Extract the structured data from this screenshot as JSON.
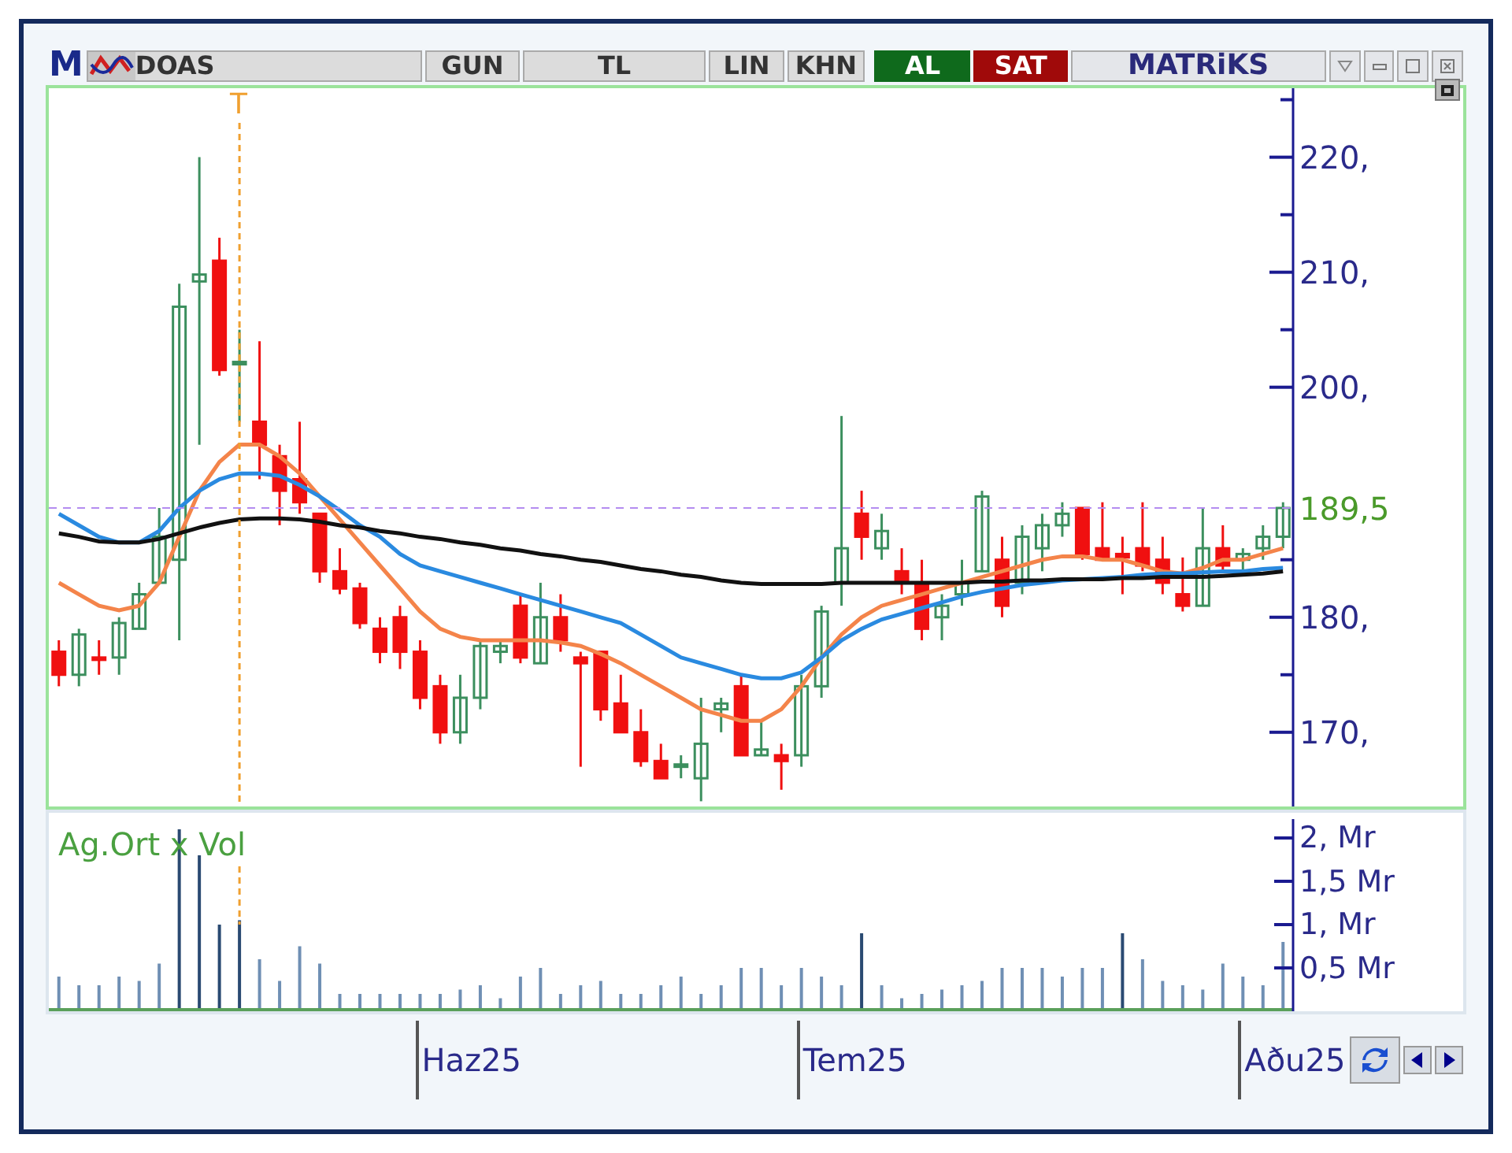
{
  "toolbar": {
    "logo": "M",
    "symbol": "DOAS",
    "buttons": [
      {
        "label": "GUN"
      },
      {
        "label": "TL"
      },
      {
        "label": "LIN"
      },
      {
        "label": "KHN"
      }
    ],
    "buy": "AL",
    "sell": "SAT",
    "brand": "MATRiKS"
  },
  "price_chart": {
    "chart_data": {
      "type": "candlestick",
      "categories": [
        null,
        null,
        null,
        null,
        null,
        null,
        null,
        null,
        null,
        null,
        null,
        null,
        null,
        null,
        null,
        null,
        null,
        null,
        null,
        null,
        null,
        null,
        null,
        null,
        null,
        null,
        null,
        null,
        null,
        null,
        null,
        null,
        null,
        null,
        null,
        null,
        null,
        null,
        null,
        null,
        null,
        null,
        null,
        null,
        null,
        null,
        null,
        null,
        null,
        null,
        null,
        null,
        null,
        null,
        null,
        null,
        null,
        null,
        null,
        null,
        null,
        null
      ],
      "ylim": [
        163,
        226
      ],
      "yticks": [
        {
          "value": 170,
          "label": "170,"
        },
        {
          "value": 180,
          "label": "180,"
        },
        {
          "value": 200,
          "label": "200,"
        },
        {
          "value": 210,
          "label": "210,"
        },
        {
          "value": 220,
          "label": "220,"
        }
      ],
      "ohlc": [
        [
          177,
          178,
          174,
          175
        ],
        [
          175,
          179,
          174,
          178.5
        ],
        [
          176.5,
          178,
          175,
          176.3
        ],
        [
          176.5,
          180,
          175,
          179.5
        ],
        [
          179,
          183,
          179,
          182
        ],
        [
          183,
          189.5,
          183,
          187
        ],
        [
          185,
          209,
          178,
          207
        ],
        [
          209.2,
          220,
          195,
          209.8
        ],
        [
          211,
          213,
          201,
          201.5
        ],
        [
          202,
          205,
          197,
          202.2
        ],
        [
          197,
          204,
          192,
          195
        ],
        [
          194,
          195,
          188,
          191
        ],
        [
          192,
          197,
          189,
          190
        ],
        [
          189,
          189,
          183,
          184
        ],
        [
          184,
          186,
          182,
          182.5
        ],
        [
          182.5,
          183,
          179,
          179.5
        ],
        [
          179,
          180,
          176,
          177
        ],
        [
          180,
          181,
          175.5,
          177
        ],
        [
          177,
          178,
          172,
          173
        ],
        [
          174,
          175,
          169,
          170
        ],
        [
          170,
          175,
          169,
          173
        ],
        [
          173,
          178,
          172,
          177.5
        ],
        [
          177,
          178,
          176,
          177.5
        ],
        [
          181,
          182,
          176,
          176.5
        ],
        [
          176,
          183,
          176,
          180
        ],
        [
          180,
          182,
          177,
          178
        ],
        [
          176.5,
          177,
          167,
          176
        ],
        [
          177,
          177,
          171,
          172
        ],
        [
          172.5,
          175,
          170,
          170
        ],
        [
          170,
          172,
          167,
          167.5
        ],
        [
          167.5,
          169,
          166,
          166
        ],
        [
          167,
          168,
          166,
          167.2
        ],
        [
          166,
          173,
          164,
          169
        ],
        [
          172,
          173,
          170,
          172.5
        ],
        [
          174,
          175,
          168,
          168
        ],
        [
          168,
          171,
          168,
          168.5
        ],
        [
          168,
          169,
          165,
          167.5
        ],
        [
          168,
          175,
          167,
          174
        ],
        [
          174,
          181,
          173,
          180.5
        ],
        [
          183,
          197.5,
          181,
          186
        ],
        [
          189,
          191,
          185,
          187
        ],
        [
          186,
          189,
          185,
          187.5
        ],
        [
          184,
          186,
          182,
          183
        ],
        [
          183,
          185,
          178,
          179
        ],
        [
          180,
          182,
          178,
          181
        ],
        [
          182,
          185,
          181,
          183
        ],
        [
          184,
          191,
          184,
          190.5
        ],
        [
          185,
          187,
          180,
          181
        ],
        [
          183,
          188,
          182,
          187
        ],
        [
          186,
          189,
          184,
          188
        ],
        [
          188,
          190,
          187,
          189
        ],
        [
          189.5,
          189.5,
          185,
          185.5
        ],
        [
          186,
          190,
          185,
          185
        ],
        [
          185.5,
          187,
          182,
          185.2
        ],
        [
          186,
          190,
          184,
          184.5
        ],
        [
          185,
          187,
          182,
          183
        ],
        [
          182,
          185.2,
          180.5,
          181
        ],
        [
          181,
          189.5,
          181,
          186
        ],
        [
          186,
          188,
          184,
          184.5
        ],
        [
          185,
          186,
          184,
          185.5
        ],
        [
          186,
          188,
          185,
          187
        ],
        [
          187,
          190,
          186,
          189.5
        ]
      ],
      "series": [
        {
          "type": "line",
          "color": "#f4844a",
          "values": [
            183,
            182,
            181,
            180.6,
            181,
            183,
            187,
            191,
            193.5,
            195,
            195,
            194,
            192.5,
            190.5,
            188.5,
            186.5,
            184.5,
            182.5,
            180.5,
            179,
            178.3,
            178,
            178,
            178,
            178,
            177.8,
            177.5,
            176.8,
            176,
            175,
            174,
            173,
            172,
            171.5,
            171,
            171,
            172,
            174,
            176.5,
            178.5,
            180,
            181,
            181.5,
            182,
            182.5,
            183,
            183.5,
            184,
            184.5,
            185,
            185.3,
            185.3,
            185,
            185,
            184.5,
            184,
            183.8,
            184.3,
            185,
            185,
            185.5,
            186
          ]
        },
        {
          "type": "line",
          "color": "#2a8ae0",
          "values": [
            189,
            188,
            187,
            186.5,
            186.5,
            187.5,
            189.5,
            191,
            192,
            192.5,
            192.5,
            192.3,
            191.5,
            190.5,
            189.3,
            188,
            187,
            185.5,
            184.5,
            184,
            183.5,
            183,
            182.5,
            182,
            181.5,
            181,
            180.5,
            180,
            179.5,
            178.5,
            177.5,
            176.5,
            176,
            175.5,
            175,
            174.7,
            174.7,
            175.2,
            176.5,
            178,
            179,
            179.8,
            180.3,
            180.8,
            181.3,
            181.8,
            182.2,
            182.5,
            182.8,
            183,
            183.2,
            183.3,
            183.4,
            183.5,
            183.7,
            183.8,
            183.8,
            183.9,
            184,
            184,
            184.2,
            184.3
          ]
        },
        {
          "type": "line",
          "color": "#111111",
          "values": [
            187.3,
            187,
            186.6,
            186.5,
            186.5,
            186.8,
            187.3,
            187.8,
            188.2,
            188.5,
            188.6,
            188.6,
            188.5,
            188.3,
            188,
            187.8,
            187.5,
            187.3,
            187,
            186.8,
            186.5,
            186.3,
            186,
            185.8,
            185.5,
            185.3,
            185,
            184.8,
            184.5,
            184.2,
            184,
            183.7,
            183.5,
            183.2,
            183,
            182.9,
            182.9,
            182.9,
            182.9,
            183,
            183,
            183,
            183,
            183,
            183,
            183,
            183.1,
            183.1,
            183.2,
            183.2,
            183.3,
            183.3,
            183.3,
            183.4,
            183.4,
            183.5,
            183.5,
            183.5,
            183.6,
            183.7,
            183.8,
            184
          ]
        }
      ],
      "ref_lines": [
        {
          "axis": "y",
          "value": 189.5,
          "label": "189,5"
        }
      ],
      "annotations": [
        "T"
      ]
    }
  },
  "volume_chart": {
    "chart_data": {
      "type": "bar",
      "title": "Ag.Ort x Vol",
      "categories": [
        null,
        null,
        null,
        null,
        null,
        null,
        null,
        null,
        null,
        null,
        null,
        null,
        null,
        null,
        null,
        null,
        null,
        null,
        null,
        null,
        null,
        null,
        null,
        null,
        null,
        null,
        null,
        null,
        null,
        null,
        null,
        null,
        null,
        null,
        null,
        null,
        null,
        null,
        null,
        null,
        null,
        null,
        null,
        null,
        null,
        null,
        null,
        null,
        null,
        null,
        null,
        null,
        null,
        null,
        null,
        null,
        null,
        null,
        null,
        null,
        null,
        null
      ],
      "ylim": [
        0,
        2.2
      ],
      "yticks": [
        {
          "value": 0.5,
          "label": "0,5 Mr"
        },
        {
          "value": 1,
          "label": "1, Mr"
        },
        {
          "value": 1.5,
          "label": "1,5 Mr"
        },
        {
          "value": 2,
          "label": "2, Mr"
        }
      ],
      "values": [
        0.4,
        0.3,
        0.3,
        0.4,
        0.35,
        0.55,
        2.1,
        1.8,
        1.0,
        1.05,
        0.6,
        0.35,
        0.75,
        0.55,
        0.2,
        0.2,
        0.2,
        0.2,
        0.2,
        0.2,
        0.25,
        0.3,
        0.15,
        0.4,
        0.5,
        0.2,
        0.3,
        0.35,
        0.2,
        0.2,
        0.3,
        0.4,
        0.2,
        0.3,
        0.5,
        0.5,
        0.3,
        0.5,
        0.4,
        0.3,
        0.9,
        0.3,
        0.15,
        0.2,
        0.25,
        0.3,
        0.35,
        0.5,
        0.5,
        0.5,
        0.4,
        0.5,
        0.5,
        0.9,
        0.6,
        0.35,
        0.3,
        0.25,
        0.55,
        0.4,
        0.3,
        0.8
      ]
    }
  },
  "time_axis": {
    "labels": [
      "Haz25",
      "Tem25",
      "Aðu25"
    ]
  }
}
